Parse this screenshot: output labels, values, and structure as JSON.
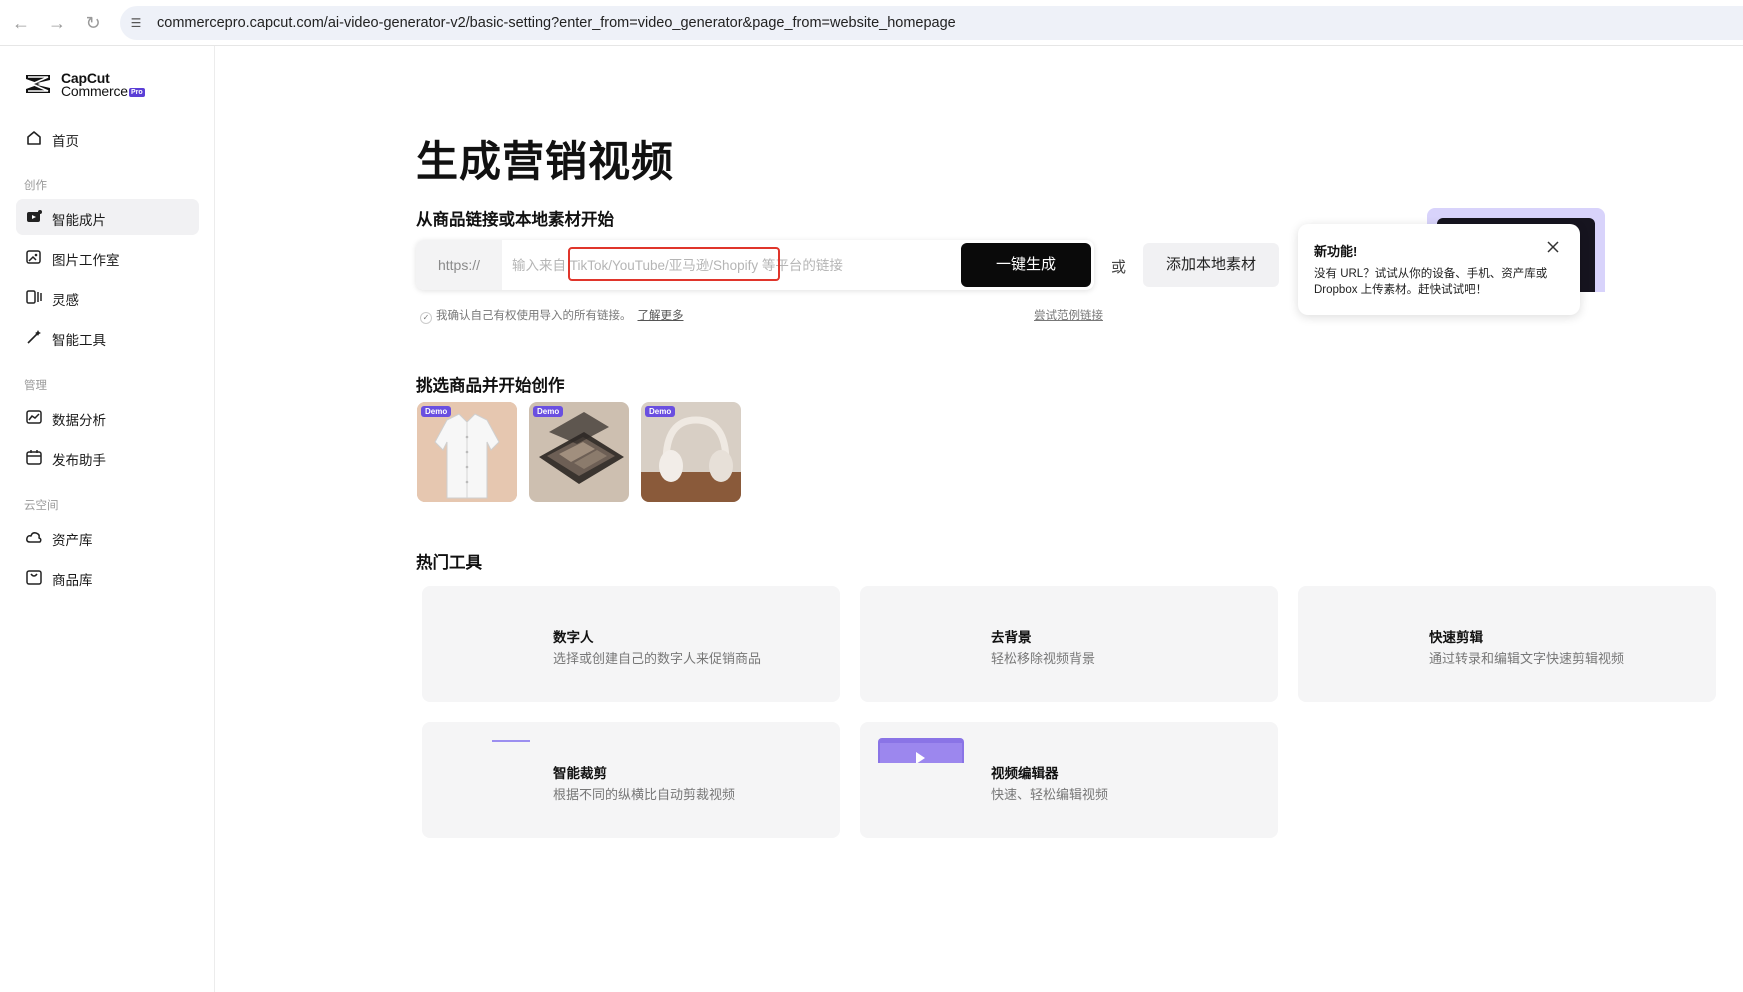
{
  "browser": {
    "url": "commercepro.capcut.com/ai-video-generator-v2/basic-setting?enter_from=video_generator&page_from=website_homepage"
  },
  "sidebar": {
    "logo_line1": "CapCut",
    "logo_line2": "Commerce",
    "logo_badge": "Pro",
    "home": "首页",
    "section_create": "创作",
    "section_manage": "管理",
    "section_cloud": "云空间",
    "items": [
      {
        "label": "智能成片",
        "icon": "smart-video-icon",
        "active": true
      },
      {
        "label": "图片工作室",
        "icon": "image-studio-icon"
      },
      {
        "label": "灵感",
        "icon": "inspiration-icon"
      },
      {
        "label": "智能工具",
        "icon": "magic-wand-icon"
      },
      {
        "label": "数据分析",
        "icon": "chart-icon"
      },
      {
        "label": "发布助手",
        "icon": "calendar-icon"
      },
      {
        "label": "资产库",
        "icon": "cloud-icon"
      },
      {
        "label": "商品库",
        "icon": "product-icon"
      }
    ]
  },
  "main": {
    "title": "生成营销视频",
    "subtitle": "从商品链接或本地素材开始",
    "https_prefix": "https://",
    "input_placeholder": "输入来自 TikTok/YouTube/亚马逊/Shopify 等平台的链接",
    "generate_button": "一键生成",
    "or_text": "或",
    "local_button": "添加本地素材",
    "confirm_text": "我确认自己有权使用导入的所有链接。",
    "learn_more": "了解更多",
    "try_sample": "尝试范例链接",
    "tooltip_title": "新功能!",
    "tooltip_body": "没有 URL？试试从你的设备、手机、资产库或 Dropbox 上传素材。赶快试试吧！",
    "products_title": "挑选商品并开始创作",
    "demo_badge": "Demo",
    "tools_title": "热门工具",
    "tools": [
      {
        "name": "数字人",
        "desc": "选择或创建自己的数字人来促销商品"
      },
      {
        "name": "去背景",
        "desc": "轻松移除视频背景"
      },
      {
        "name": "快速剪辑",
        "desc": "通过转录和编辑文字快速剪辑视频"
      },
      {
        "name": "智能裁剪",
        "desc": "根据不同的纵横比自动剪裁视频"
      },
      {
        "name": "视频编辑器",
        "desc": "快速、轻松编辑视频"
      }
    ]
  },
  "colors": {
    "accent": "#5b3fd6",
    "highlight": "#e0352b",
    "primary_button": "#0a0a0a"
  }
}
